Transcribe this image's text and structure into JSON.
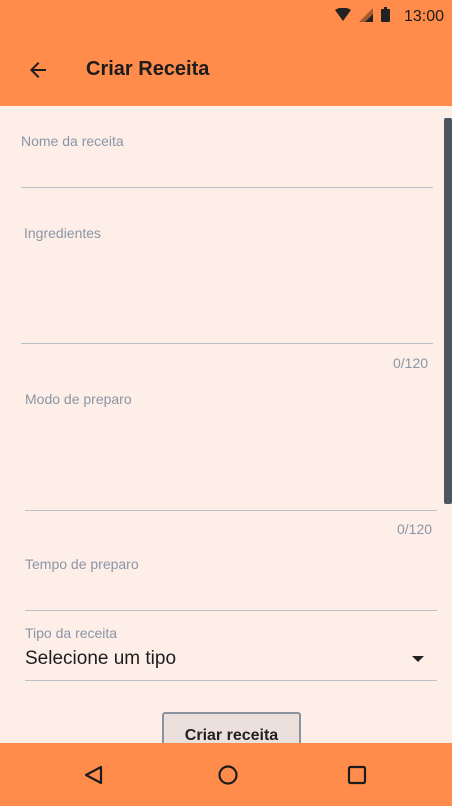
{
  "status_bar": {
    "time": "13:00",
    "icons": [
      "wifi-icon",
      "signal-icon",
      "battery-icon"
    ]
  },
  "app_bar": {
    "title": "Criar Receita",
    "back_icon": "arrow-left-icon"
  },
  "form": {
    "name_label": "Nome da receita",
    "ingredients_label": "Ingredientes",
    "ingredients_counter": "0/120",
    "method_label": "Modo de preparo",
    "method_counter": "0/120",
    "time_label": "Tempo de preparo",
    "type_label": "Tipo da receita",
    "type_selected": "Selecione um tipo",
    "submit_label": "Criar receita"
  },
  "nav_bar": {
    "icons": [
      "back-triangle-icon",
      "home-circle-icon",
      "recents-square-icon"
    ]
  },
  "colors": {
    "accent": "#ff8c4a",
    "background": "#fdeee8",
    "label": "#8a96a6"
  }
}
